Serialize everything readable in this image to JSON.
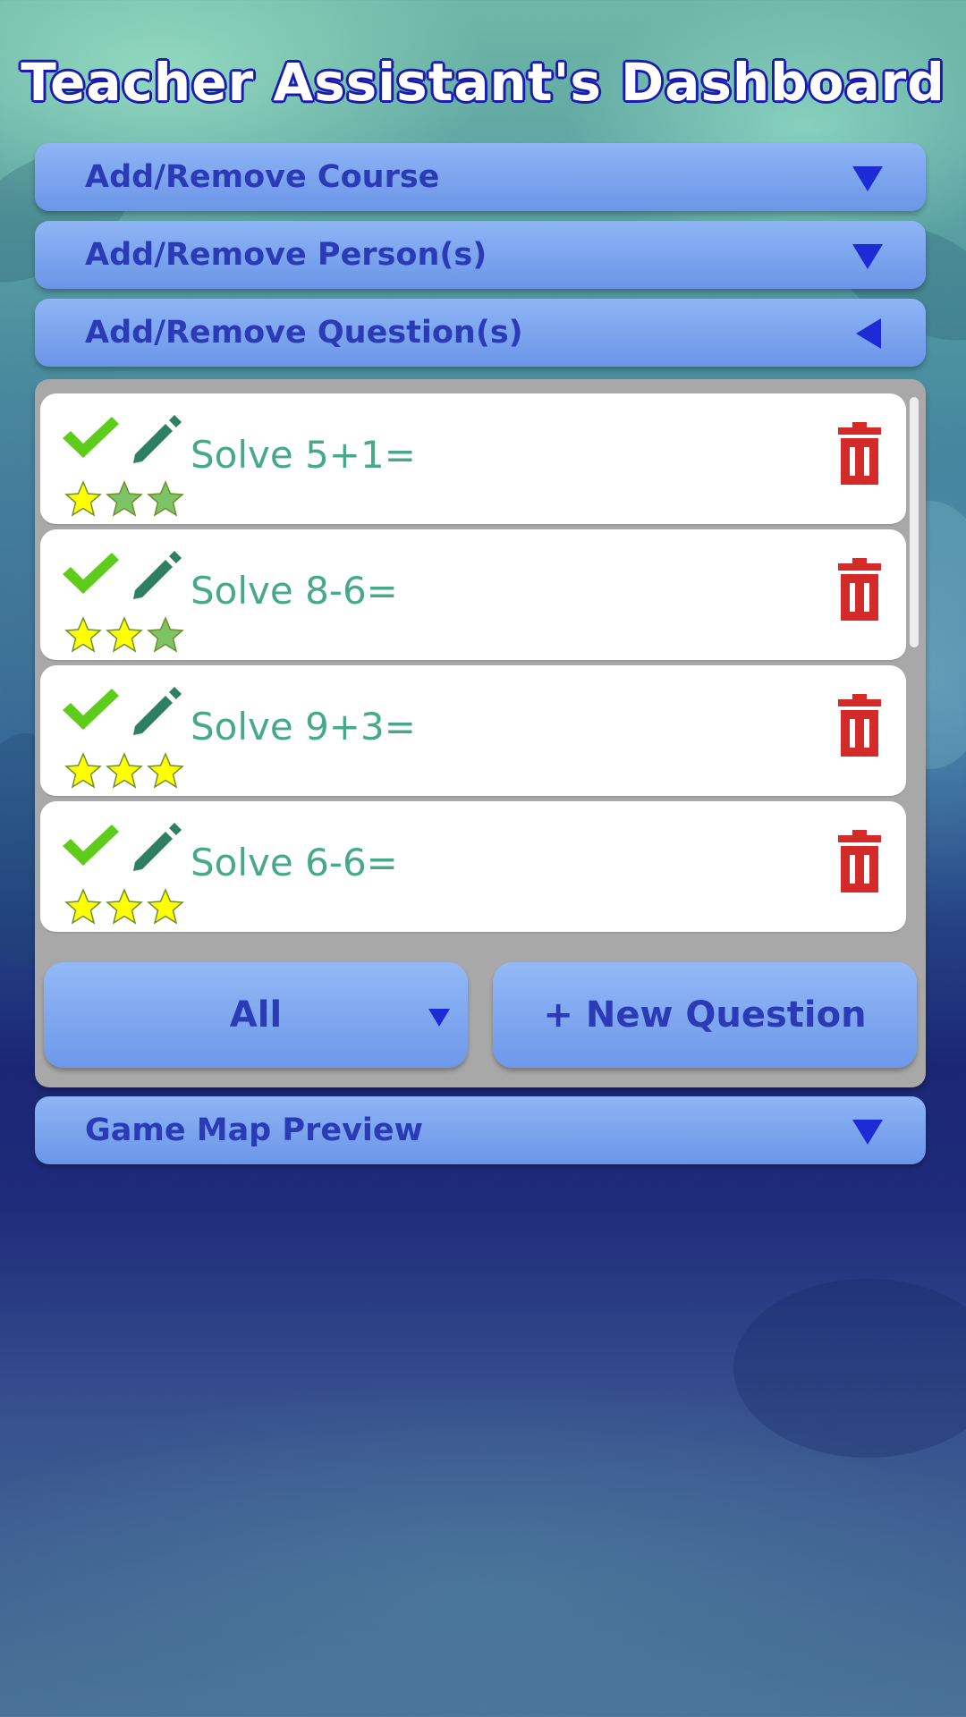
{
  "title": "Teacher Assistant's Dashboard",
  "sections": [
    {
      "label": "Add/Remove Course",
      "state": "collapsed"
    },
    {
      "label": "Add/Remove Person(s)",
      "state": "collapsed"
    },
    {
      "label": "Add/Remove Question(s)",
      "state": "expanded"
    },
    {
      "label": "Game Map Preview",
      "state": "collapsed"
    }
  ],
  "questions": [
    {
      "text": "Solve 5+1=",
      "rating": 1,
      "max_rating": 3
    },
    {
      "text": "Solve 8-6=",
      "rating": 2,
      "max_rating": 3
    },
    {
      "text": "Solve 9+3=",
      "rating": 3,
      "max_rating": 3
    },
    {
      "text": "Solve 6-6=",
      "rating": 3,
      "max_rating": 3
    }
  ],
  "filter": {
    "label": "All"
  },
  "new_question_label": "+ New Question",
  "colors": {
    "title_outline": "#1b1bb0",
    "accordion": "#7fa6f0",
    "accordion_text": "#2a3bb5",
    "question_text": "#47a88a",
    "check": "#5ecc1a",
    "pencil": "#2f7f63",
    "trash": "#d42a2a",
    "star_filled": "#ffff00",
    "star_empty": "#7cc466"
  },
  "icons": [
    "check-icon",
    "pencil-icon",
    "trash-icon",
    "star-icon",
    "caret-down-icon",
    "caret-left-icon"
  ]
}
